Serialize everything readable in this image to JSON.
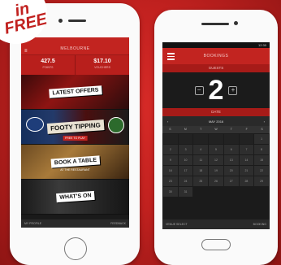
{
  "badge": {
    "line1": "in",
    "line2": "FREE"
  },
  "iphone": {
    "header_title": "MELBOURNE",
    "stats": [
      {
        "value": "427.5",
        "label": "POINTS"
      },
      {
        "value": "$17.10",
        "label": "VOUCHERS"
      }
    ],
    "tiles": [
      {
        "label": "LATEST OFFERS"
      },
      {
        "label": "FOOTY TIPPING",
        "sub": "FREE TO PLAY"
      },
      {
        "label": "BOOK A TABLE",
        "sub": "AT THE RESTAURANT"
      },
      {
        "label": "WHAT'S ON"
      }
    ],
    "footer_left": "MY PROFILE",
    "footer_right": "FEEDBACK"
  },
  "android": {
    "status_text": "12:30",
    "header_title": "BOOKINGS",
    "guests_label": "GUESTS",
    "guests_value": "2",
    "minus": "−",
    "plus": "+",
    "date_label": "DATE",
    "month_label": "MAY 2016",
    "prev": "‹",
    "next": "›",
    "weekdays": [
      "S",
      "M",
      "T",
      "W",
      "T",
      "F",
      "S"
    ],
    "days": [
      "",
      "",
      "",
      "",
      "",
      "",
      "1",
      "2",
      "3",
      "4",
      "5",
      "6",
      "7",
      "8",
      "9",
      "10",
      "11",
      "12",
      "13",
      "14",
      "15",
      "16",
      "17",
      "18",
      "19",
      "20",
      "21",
      "22",
      "23",
      "24",
      "25",
      "26",
      "27",
      "28",
      "29",
      "30",
      "31"
    ],
    "footer_left": "VENUE SELECT",
    "footer_right": "BOOKING"
  },
  "colors": {
    "brand_red": "#c22420",
    "background": "#c1211f"
  }
}
